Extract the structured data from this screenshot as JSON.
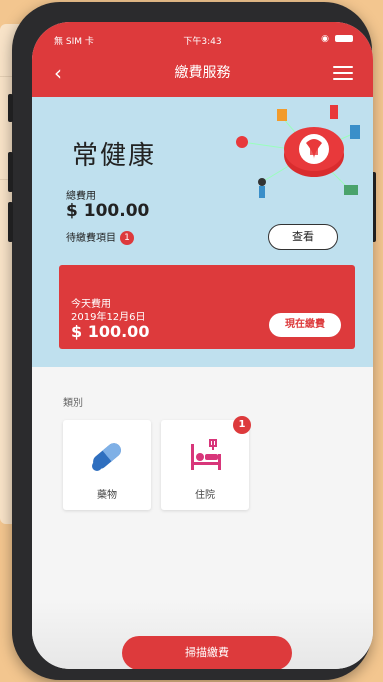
{
  "status_bar": {
    "carrier": "無 SIM 卡",
    "time": "下午3:43"
  },
  "header": {
    "title": "繳費服務"
  },
  "hero": {
    "brand": "常健康",
    "total_label": "總費用",
    "total_value": "$ 100.00",
    "pending_label": "待繳費項目",
    "pending_count": "1",
    "view_button": "查看"
  },
  "today": {
    "label": "今天費用",
    "date": "2019年12月6日",
    "amount": "$ 100.00",
    "pay_button": "現在繳費"
  },
  "categories": {
    "label": "類別",
    "items": [
      {
        "label": "藥物",
        "icon": "pill-icon"
      },
      {
        "label": "住院",
        "icon": "hospital-bed-icon",
        "badge": "1"
      }
    ]
  },
  "scan_button": "掃描繳費",
  "colors": {
    "accent": "#dd3a3c",
    "hero_bg": "#bfe0ee"
  }
}
